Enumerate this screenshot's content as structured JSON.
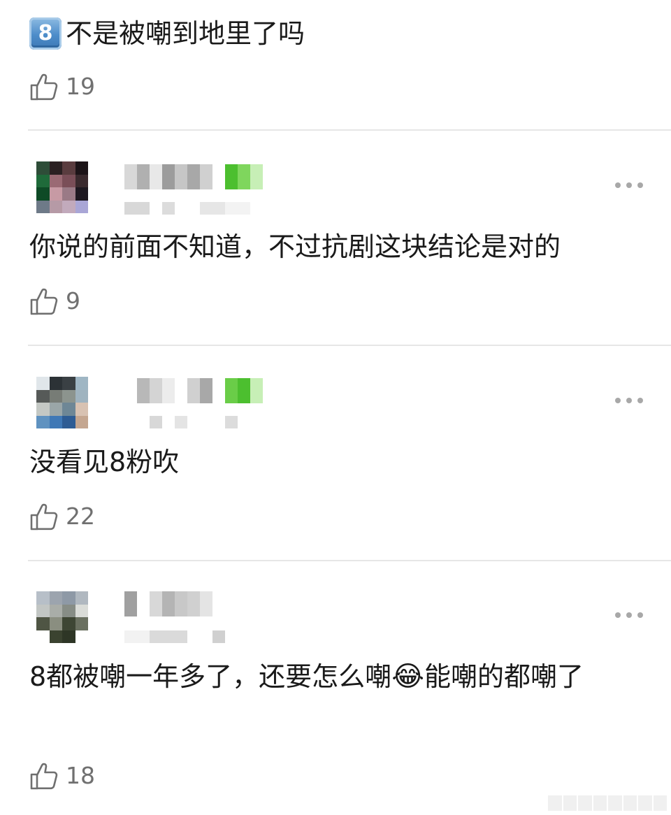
{
  "top_comment": {
    "badge": "8",
    "text": "不是被嘲到地里了吗",
    "likes": "19"
  },
  "comments": [
    {
      "text": "你说的前面不知道，不过抗剧这块结论是对的",
      "likes": "9",
      "more_icon": "more-icon"
    },
    {
      "text": "没看见8粉吹",
      "likes": "22",
      "more_icon": "more-icon"
    },
    {
      "text_before_emoji": "8都被嘲一年多了，还要怎么嘲",
      "emoji": "😂",
      "text_after_emoji": "能嘲的都嘲了",
      "likes": "18",
      "more_icon": "more-icon"
    }
  ],
  "icons": {
    "like": "thumbs-up-icon",
    "more": "more-horizontal-icon",
    "badge": "keycap-8-icon"
  },
  "colors": {
    "text": "#1a1a1a",
    "muted": "#707070",
    "divider": "#e6e6e6",
    "dots": "#a8a8a8",
    "verified_green": "#4cbf2f"
  }
}
